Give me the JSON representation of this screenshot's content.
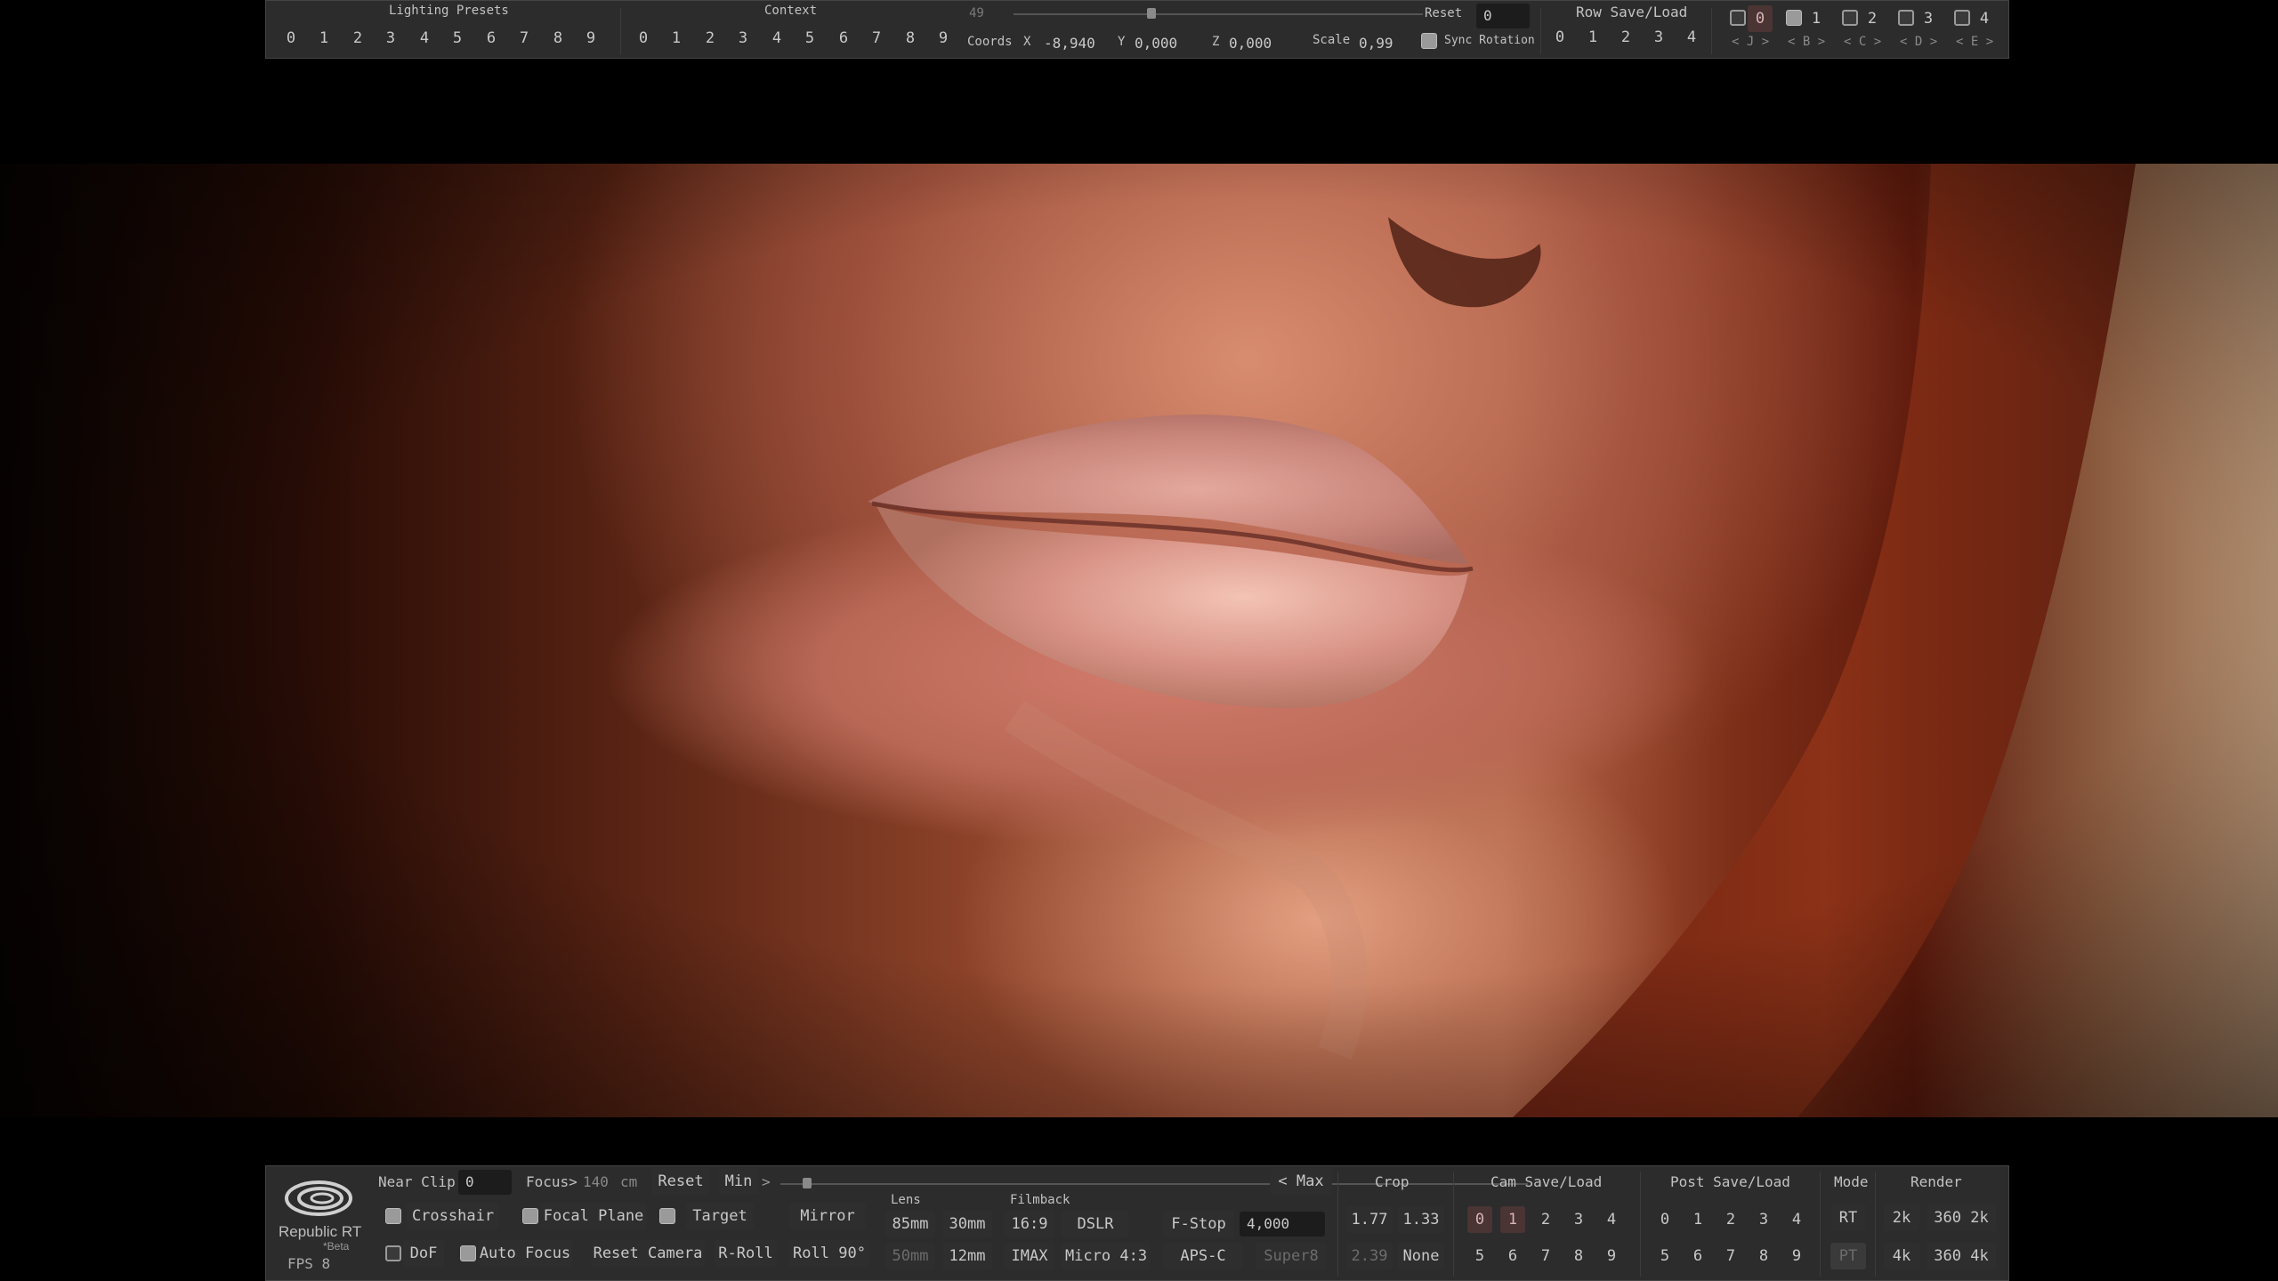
{
  "top": {
    "lighting_presets": {
      "title": "Lighting Presets",
      "buttons": [
        "0",
        "1",
        "2",
        "3",
        "4",
        "5",
        "6",
        "7",
        "8",
        "9"
      ]
    },
    "context": {
      "title": "Context",
      "buttons": [
        "0",
        "1",
        "2",
        "3",
        "4",
        "5",
        "6",
        "7",
        "8",
        "9"
      ]
    },
    "slider_value": "49",
    "coords": {
      "label": "Coords",
      "x_label": "X",
      "x_value": "-8,940",
      "y_label": "Y",
      "y_value": "0,000",
      "z_label": "Z",
      "z_value": "0,000"
    },
    "scale": {
      "label": "Scale",
      "value": "0,99"
    },
    "reset": {
      "label": "Reset",
      "value": "0"
    },
    "sync_rotation": "Sync Rotation",
    "row_save_load": {
      "title": "Row Save/Load",
      "buttons": [
        "0",
        "1",
        "2",
        "3",
        "4"
      ]
    },
    "layers": [
      {
        "num": "0",
        "nav": "< J >"
      },
      {
        "num": "1",
        "nav": "< B >"
      },
      {
        "num": "2",
        "nav": "< C >"
      },
      {
        "num": "3",
        "nav": "< D >"
      },
      {
        "num": "4",
        "nav": "< E >"
      }
    ]
  },
  "bottom": {
    "logo": {
      "name": "Republic RT",
      "sub": "*Beta"
    },
    "fps": "FPS 8",
    "near_clip": {
      "label": "Near Clip",
      "value": "0"
    },
    "focus": {
      "label": "Focus>",
      "value": "140",
      "unit": "cm"
    },
    "reset": "Reset",
    "min": "Min",
    "min_arrow": ">",
    "max": "< Max",
    "crosshair": "Crosshair",
    "focal_plane": "Focal Plane",
    "target": "Target",
    "mirror": "Mirror",
    "dof": "DoF",
    "auto_focus": "Auto Focus",
    "reset_camera": "Reset Camera",
    "r_roll": "R-Roll",
    "roll90": "Roll 90°",
    "lens": {
      "label": "Lens",
      "options": [
        "85mm",
        "30mm",
        "50mm",
        "12mm"
      ]
    },
    "filmback": {
      "label": "Filmback",
      "options": [
        "16:9",
        "DSLR",
        "IMAX",
        "Micro 4:3",
        "APS-C",
        "Super8"
      ]
    },
    "fstop": {
      "label": "F-Stop",
      "value": "4,000"
    },
    "crop": {
      "label": "Crop",
      "options": [
        "1.77",
        "1.33",
        "2.39",
        "None"
      ]
    },
    "cam_save_load": {
      "title": "Cam Save/Load",
      "row1": [
        "0",
        "1",
        "2",
        "3",
        "4"
      ],
      "row2": [
        "5",
        "6",
        "7",
        "8",
        "9"
      ]
    },
    "post_save_load": {
      "title": "Post Save/Load",
      "row1": [
        "0",
        "1",
        "2",
        "3",
        "4"
      ],
      "row2": [
        "5",
        "6",
        "7",
        "8",
        "9"
      ]
    },
    "mode": {
      "title": "Mode",
      "options": [
        "RT",
        "PT"
      ]
    },
    "render": {
      "title": "Render",
      "options": [
        "2k",
        "360 2k",
        "4k",
        "360 4k"
      ]
    }
  }
}
